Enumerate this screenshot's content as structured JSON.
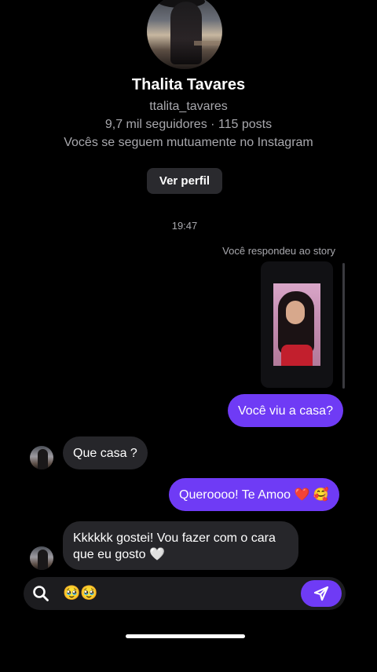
{
  "profile": {
    "name": "Thalita Tavares",
    "handle": "ttalita_tavares",
    "stats": "9,7 mil seguidores · 115 posts",
    "mutual": "Vocês se seguem mutuamente no Instagram",
    "view_profile_label": "Ver perfil"
  },
  "thread": {
    "timestamp": "19:47",
    "story_note": "Você respondeu ao story",
    "messages": [
      {
        "from": "me",
        "text": "Você viu a casa?"
      },
      {
        "from": "them",
        "text": "Que casa ?"
      },
      {
        "from": "me",
        "text": "Queroooo! Te Amoo ❤️ 🥰"
      },
      {
        "from": "them",
        "text": "Kkkkkk gostei! Vou fazer com o cara que eu gosto 🤍"
      }
    ]
  },
  "composer": {
    "value": "🥹🥹",
    "search_icon": "search-icon",
    "send_icon": "send-icon"
  },
  "colors": {
    "background": "#000000",
    "outgoing_bubble": "#6f3bf5",
    "incoming_bubble": "#26262a",
    "secondary_text": "#a8a8ad"
  }
}
